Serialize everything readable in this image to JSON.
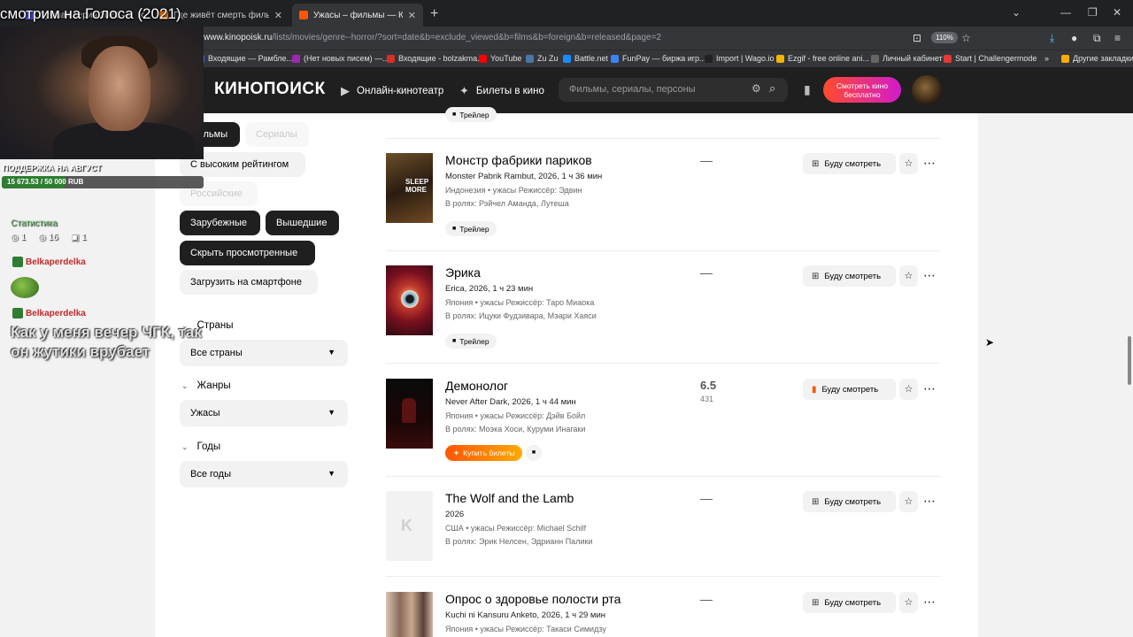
{
  "browser": {
    "tabs": [
      {
        "label": "Лучшая серия 2021 — Кинопоиск",
        "color": "#5a5aff"
      },
      {
        "label": "Где живёт смерть фильм",
        "color": "#ff7a00"
      },
      {
        "label": "Ужасы – фильмы — Кинопоиск",
        "color": "#ff5500",
        "active": true
      }
    ],
    "url_host": "www.kinopoisk.ru",
    "url_path": "/lists/movies/genre--horror/?sort=date&b=exclude_viewed&b=films&b=foreign&b=released&page=2",
    "zoom": "110%",
    "bookmarks": [
      {
        "label": "Входящие — Рамбле...",
        "color": "#3a66ff"
      },
      {
        "label": "(Нет новых писем) —...",
        "color": "#9c27b0"
      },
      {
        "label": "Входящие - bolzakma...",
        "color": "#d93025"
      },
      {
        "label": "YouTube",
        "color": "#ff0000"
      },
      {
        "label": "Zu Zu",
        "color": "#4a76a8"
      },
      {
        "label": "Battle.net",
        "color": "#148eff"
      },
      {
        "label": "FunPay — биржа игр...",
        "color": "#3b82f6"
      },
      {
        "label": "Import | Wago.io",
        "color": "#222222"
      },
      {
        "label": "Ezgif - free online ani...",
        "color": "#f4b400"
      },
      {
        "label": "Личный кабинет",
        "color": "#666666"
      },
      {
        "label": "Start | Challengermode",
        "color": "#e53935"
      }
    ],
    "other_bookmarks": "Другие закладки"
  },
  "site": {
    "logo": "КИНОПОИСК",
    "nav": [
      "Онлайн-кинотеатр",
      "Билеты в кино"
    ],
    "search_placeholder": "Фильмы, сериалы, персоны",
    "promo": "Смотреть кино бесплатно"
  },
  "filters": {
    "chips": [
      {
        "label": "Фильмы",
        "style": "dark"
      },
      {
        "label": "Сериалы",
        "style": "dim"
      },
      {
        "label": "С высоким рейтингом",
        "style": "light"
      },
      {
        "label": "Российские",
        "style": "dim"
      },
      {
        "label": "Зарубежные",
        "style": "dark"
      },
      {
        "label": "Вышедшие",
        "style": "dark"
      },
      {
        "label": "Скрыть просмотренные",
        "style": "dark"
      },
      {
        "label": "Загрузить на смартфоне",
        "style": "light"
      }
    ],
    "groups": [
      {
        "title": "Страны",
        "value": "Все страны"
      },
      {
        "title": "Жанры",
        "value": "Ужасы"
      },
      {
        "title": "Годы",
        "value": "Все годы"
      }
    ]
  },
  "films": [
    {
      "title": "Монстр фабрики париков",
      "subtitle": "Monster Pabrik Rambut, 2026, 1 ч 36 мин",
      "meta": "Индонезия • ужасы  Режиссёр: Эдвин",
      "cast": "В ролях: Рэйчел Аманда, Лутеша",
      "rating": "—",
      "votes": "",
      "action": "Трейлер",
      "watch_label": "Буду смотреть"
    },
    {
      "title": "Эрика",
      "subtitle": "Erica, 2026, 1 ч 23 мин",
      "meta": "Япония • ужасы  Режиссёр: Таро Миаока",
      "cast": "В ролях: Ицуки Фудзивара, Мэари Хаяси",
      "rating": "—",
      "votes": "",
      "action": "Трейлер",
      "watch_label": "Буду смотреть"
    },
    {
      "title": "Демонолог",
      "subtitle": "Never After Dark, 2026, 1 ч 44 мин",
      "meta": "Япония • ужасы  Режиссёр: Дэйв Бойл",
      "cast": "В ролях: Моэка Хоси, Куруми Инагаки",
      "rating": "6.5",
      "votes": "431",
      "action": "Купить билеты",
      "watch_label": "Буду смотреть"
    },
    {
      "title": "The Wolf and the Lamb",
      "subtitle": "2026",
      "meta": "США • ужасы  Режиссёр: Michael Schilf",
      "cast": "В ролях: Эрик Нелсен, Эдрианн Палики",
      "rating": "—",
      "votes": "",
      "action": "",
      "watch_label": "Буду смотреть"
    },
    {
      "title": "Опрос о здоровье полости рта",
      "subtitle": "Kuchi ni Kansuru Anketo, 2026, 1 ч 29 мин",
      "meta": "Япония • ужасы  Режиссёр: Такаси Симидзу",
      "cast": "",
      "rating": "—",
      "votes": "",
      "action": "",
      "watch_label": "Буду смотреть"
    }
  ],
  "top_trailer": "Трейлер",
  "overlay": {
    "stream_title": "смотрим на Голоса (2021)",
    "support_label": "ПОДДЕРЖКА НА АВГУСТ",
    "support_text": "15 673.53 / 50 000 RUB",
    "support_progress": 0.31,
    "stats_label": "Статистика",
    "stats": [
      "1",
      "16",
      "1"
    ],
    "chat_user_1": "Belkaperdelka",
    "chat_user_2": "Belkaperdelka",
    "chat_message": "Как у меня вечер ЧГК, так он жутики врубает"
  }
}
